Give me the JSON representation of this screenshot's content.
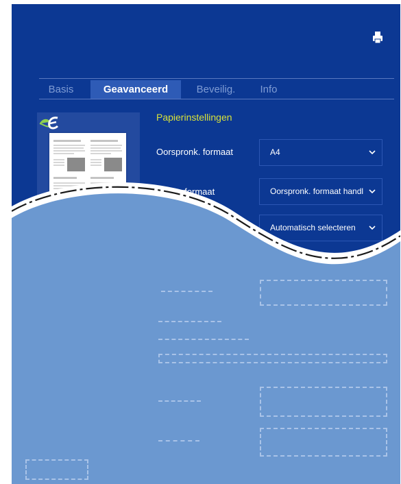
{
  "colors": {
    "background": "#0c3893",
    "active_tab": "#2e5bb6",
    "section_title": "#d8e23a",
    "lower_panel": "#6b98d0"
  },
  "tabs": [
    {
      "label": "Basis",
      "active": false
    },
    {
      "label": "Geavanceerd",
      "active": true
    },
    {
      "label": "Beveilig.",
      "active": false
    },
    {
      "label": "Info",
      "active": false
    }
  ],
  "icons": {
    "printer": "printer-icon",
    "logo": "eco-leaf-logo-icon"
  },
  "settings": {
    "section_title": "Papierinstellingen",
    "original_size": {
      "label": "Oorspronk. formaat",
      "value": "A4"
    },
    "output_size": {
      "label": "Uitvoerformaat",
      "value": "Oorspronk. formaat handl"
    },
    "auto_select": {
      "value": "Automatisch selecteren"
    }
  }
}
